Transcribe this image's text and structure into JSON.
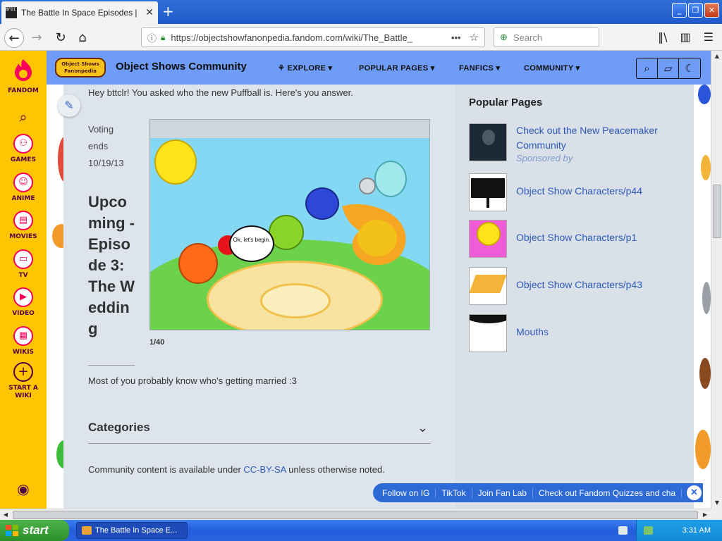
{
  "browser": {
    "tab_title": "The Battle In Space Episodes | Ob",
    "tab_favicon_text": "BFDI",
    "url": "https://objectshowfanonpedia.fandom.com/wiki/The_Battle_",
    "search_placeholder": "Search"
  },
  "fandom_rail": {
    "brand": "FANDOM",
    "items": [
      {
        "label": "GAMES",
        "icon": "gamepad-icon"
      },
      {
        "label": "ANIME",
        "icon": "anime-icon"
      },
      {
        "label": "MOVIES",
        "icon": "movies-icon"
      },
      {
        "label": "TV",
        "icon": "tv-icon"
      },
      {
        "label": "VIDEO",
        "icon": "video-icon"
      },
      {
        "label": "WIKIS",
        "icon": "wikis-icon"
      },
      {
        "label": "START A WIKI",
        "icon": "plus-icon"
      }
    ]
  },
  "wiki_header": {
    "logo_text": "Object Shows Fanonpedia",
    "name": "Object Shows Community",
    "nav": [
      "EXPLORE",
      "POPULAR PAGES",
      "FANFICS",
      "COMMUNITY"
    ]
  },
  "article": {
    "intro": "Hey bttclr! You asked who the new Puffball is. Here's you answer.",
    "voting_line1": "Voting",
    "voting_line2": "ends",
    "voting_date": "10/19/13",
    "title": "Upcoming - Episode 3: The Wedding",
    "speech_bubble": "Ok, let's begin.",
    "slide_counter": "1/40",
    "description": "Most of you probably know who's getting married :3",
    "categories_label": "Categories",
    "license_prefix": "Community content is available under",
    "license_link": "CC-BY-SA",
    "license_suffix": "unless otherwise noted."
  },
  "popular_pages": {
    "title": "Popular Pages",
    "items": [
      {
        "label": "Check out the New Peacemaker Community",
        "sponsored": "Sponsored by"
      },
      {
        "label": "Object Show Characters/p44"
      },
      {
        "label": "Object Show Characters/p1"
      },
      {
        "label": "Object Show Characters/p43"
      },
      {
        "label": "Mouths"
      }
    ]
  },
  "link_strip": [
    "Follow on IG",
    "TikTok",
    "Join Fan Lab",
    "Check out Fandom Quizzes and cha"
  ],
  "taskbar": {
    "start": "start",
    "task": "The Battle In Space E...",
    "clock": "3:31 AM"
  },
  "colors": {
    "fandom_yellow": "#ffc500",
    "fandom_pink": "#fa005a",
    "wiki_header_blue": "#6e9cf6",
    "link_blue": "#2e5ab8",
    "strip_blue": "#2e6ad6"
  }
}
